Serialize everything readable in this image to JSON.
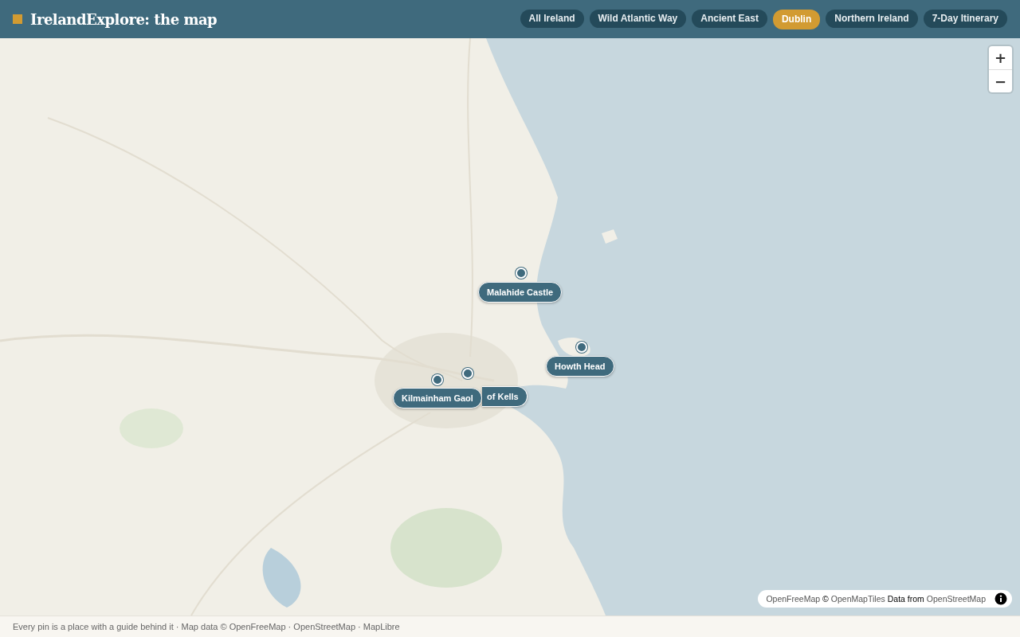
{
  "header": {
    "title": "IrelandExplore: the map"
  },
  "tabs": [
    {
      "label": "All Ireland",
      "selected": false
    },
    {
      "label": "Wild Atlantic Way",
      "selected": false
    },
    {
      "label": "Ancient East",
      "selected": false
    },
    {
      "label": "Dublin",
      "selected": true
    },
    {
      "label": "Northern Ireland",
      "selected": false
    },
    {
      "label": "7-Day Itinerary",
      "selected": false
    }
  ],
  "map": {
    "kind": "picture",
    "zoom_controls": [
      "+",
      "−"
    ],
    "pins": [
      {
        "label": "Malahide Castle"
      },
      {
        "label": "Howth Head"
      },
      {
        "label": "of Kells"
      },
      {
        "label": "Kilmainham Gaol"
      }
    ],
    "attribution": [
      {
        "text": "OpenFreeMap",
        "kind": "link"
      },
      {
        "text": "©",
        "kind": "plain"
      },
      {
        "text": "OpenMapTiles",
        "kind": "link"
      },
      {
        "text": "Data from",
        "kind": "plain"
      },
      {
        "text": "OpenStreetMap",
        "kind": "link"
      }
    ]
  },
  "footer": {
    "text": "Every pin is a place with a guide behind it · Map data © OpenFreeMap · OpenStreetMap · MapLibre"
  }
}
